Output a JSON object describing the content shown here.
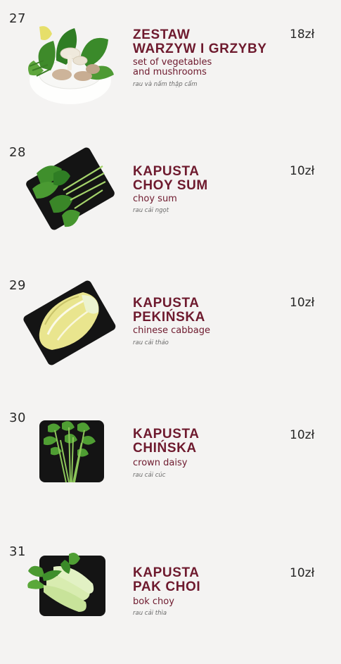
{
  "items": [
    {
      "number": "27",
      "name_lines": [
        "ZESTAW",
        "WARZYW I GRZYBY"
      ],
      "english_lines": [
        "set of vegetables",
        "and mushrooms"
      ],
      "vietnamese": "rau và nấm thập cẩm",
      "price": "18zł",
      "icon": "vegetables-and-mushrooms-bowl"
    },
    {
      "number": "28",
      "name_lines": [
        "KAPUSTA",
        "CHOY SUM"
      ],
      "english_lines": [
        "choy sum"
      ],
      "vietnamese": "rau cải ngọt",
      "price": "10zł",
      "icon": "choy-sum-plate"
    },
    {
      "number": "29",
      "name_lines": [
        "KAPUSTA",
        "PEKIŃSKA"
      ],
      "english_lines": [
        "chinese cabbage"
      ],
      "vietnamese": "rau cải thảo",
      "price": "10zł",
      "icon": "chinese-cabbage-plate"
    },
    {
      "number": "30",
      "name_lines": [
        "KAPUSTA",
        "CHIŃSKA"
      ],
      "english_lines": [
        "crown daisy"
      ],
      "vietnamese": "rau cải cúc",
      "price": "10zł",
      "icon": "crown-daisy-plate"
    },
    {
      "number": "31",
      "name_lines": [
        "KAPUSTA",
        "PAK CHOI"
      ],
      "english_lines": [
        "bok choy"
      ],
      "vietnamese": "rau cải thìa",
      "price": "10zł",
      "icon": "bok-choy-plate"
    }
  ],
  "colors": {
    "background": "#f4f3f2",
    "title": "#6e1a2e",
    "plate": "#141414",
    "leaf_dark": "#2f7d24",
    "leaf_light": "#6fb83f",
    "cabbage": "#e9e58e"
  }
}
